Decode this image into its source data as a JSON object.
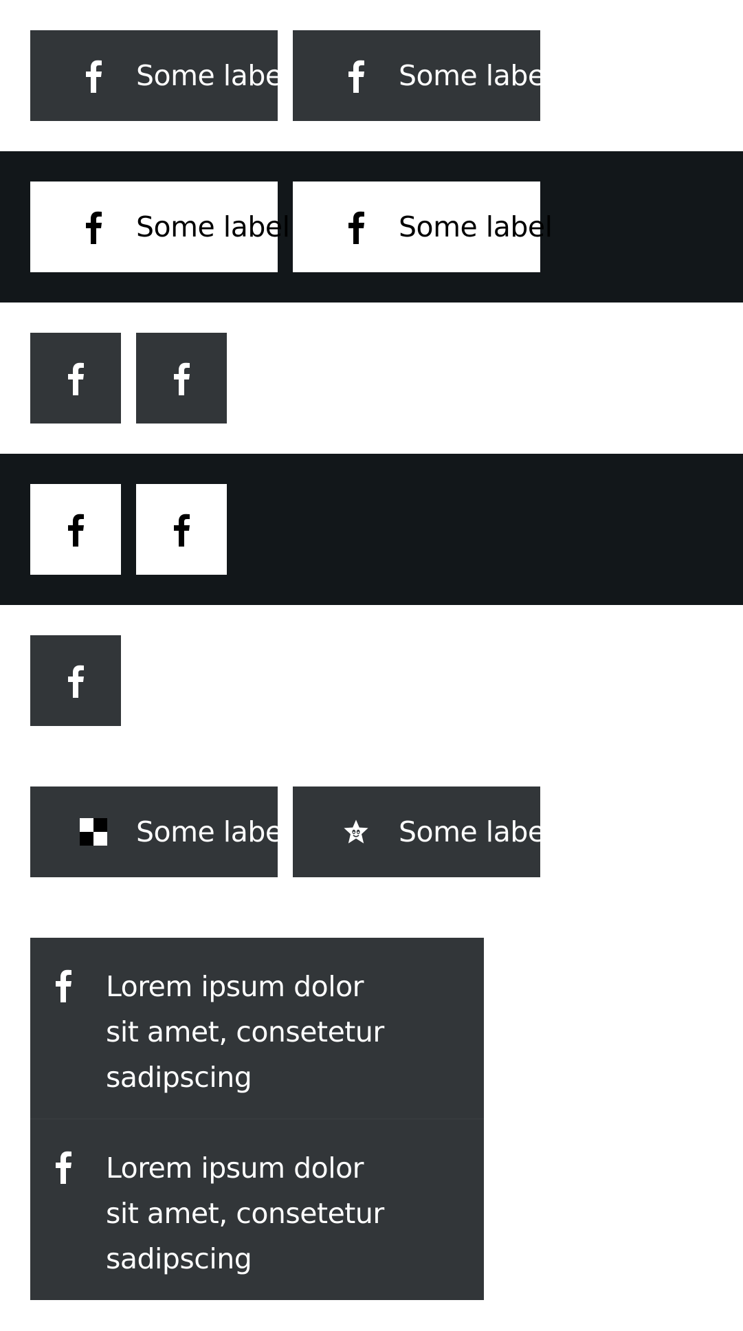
{
  "rows": [
    {
      "theme": "light",
      "buttons": [
        {
          "label": "Some label",
          "icon": "facebook-icon"
        },
        {
          "label": "Some label",
          "icon": "facebook-icon"
        }
      ]
    },
    {
      "theme": "dark",
      "buttons": [
        {
          "label": "Some label",
          "icon": "facebook-icon"
        },
        {
          "label": "Some label",
          "icon": "facebook-icon"
        }
      ]
    },
    {
      "theme": "light",
      "buttons": [
        {
          "icon": "facebook-icon"
        },
        {
          "icon": "facebook-icon"
        }
      ]
    },
    {
      "theme": "dark",
      "buttons": [
        {
          "icon": "facebook-icon"
        },
        {
          "icon": "facebook-icon"
        }
      ]
    },
    {
      "theme": "light",
      "buttons": [
        {
          "icon": "facebook-icon"
        }
      ]
    },
    {
      "theme": "light",
      "buttons": [
        {
          "label": "Some label",
          "icon": "checkered-square-icon"
        },
        {
          "label": "Some label",
          "icon": "star-face-icon"
        }
      ]
    }
  ],
  "list": {
    "items": [
      {
        "text": "Lorem ipsum dolor sit amet, consetetur sadipscing",
        "icon": "facebook-icon"
      },
      {
        "text": "Lorem ipsum dolor sit amet, consetetur sadipscing",
        "icon": "facebook-icon"
      }
    ]
  },
  "colors": {
    "button_dark": "#323639",
    "band_dark": "#12171a",
    "button_light": "#ffffff"
  }
}
